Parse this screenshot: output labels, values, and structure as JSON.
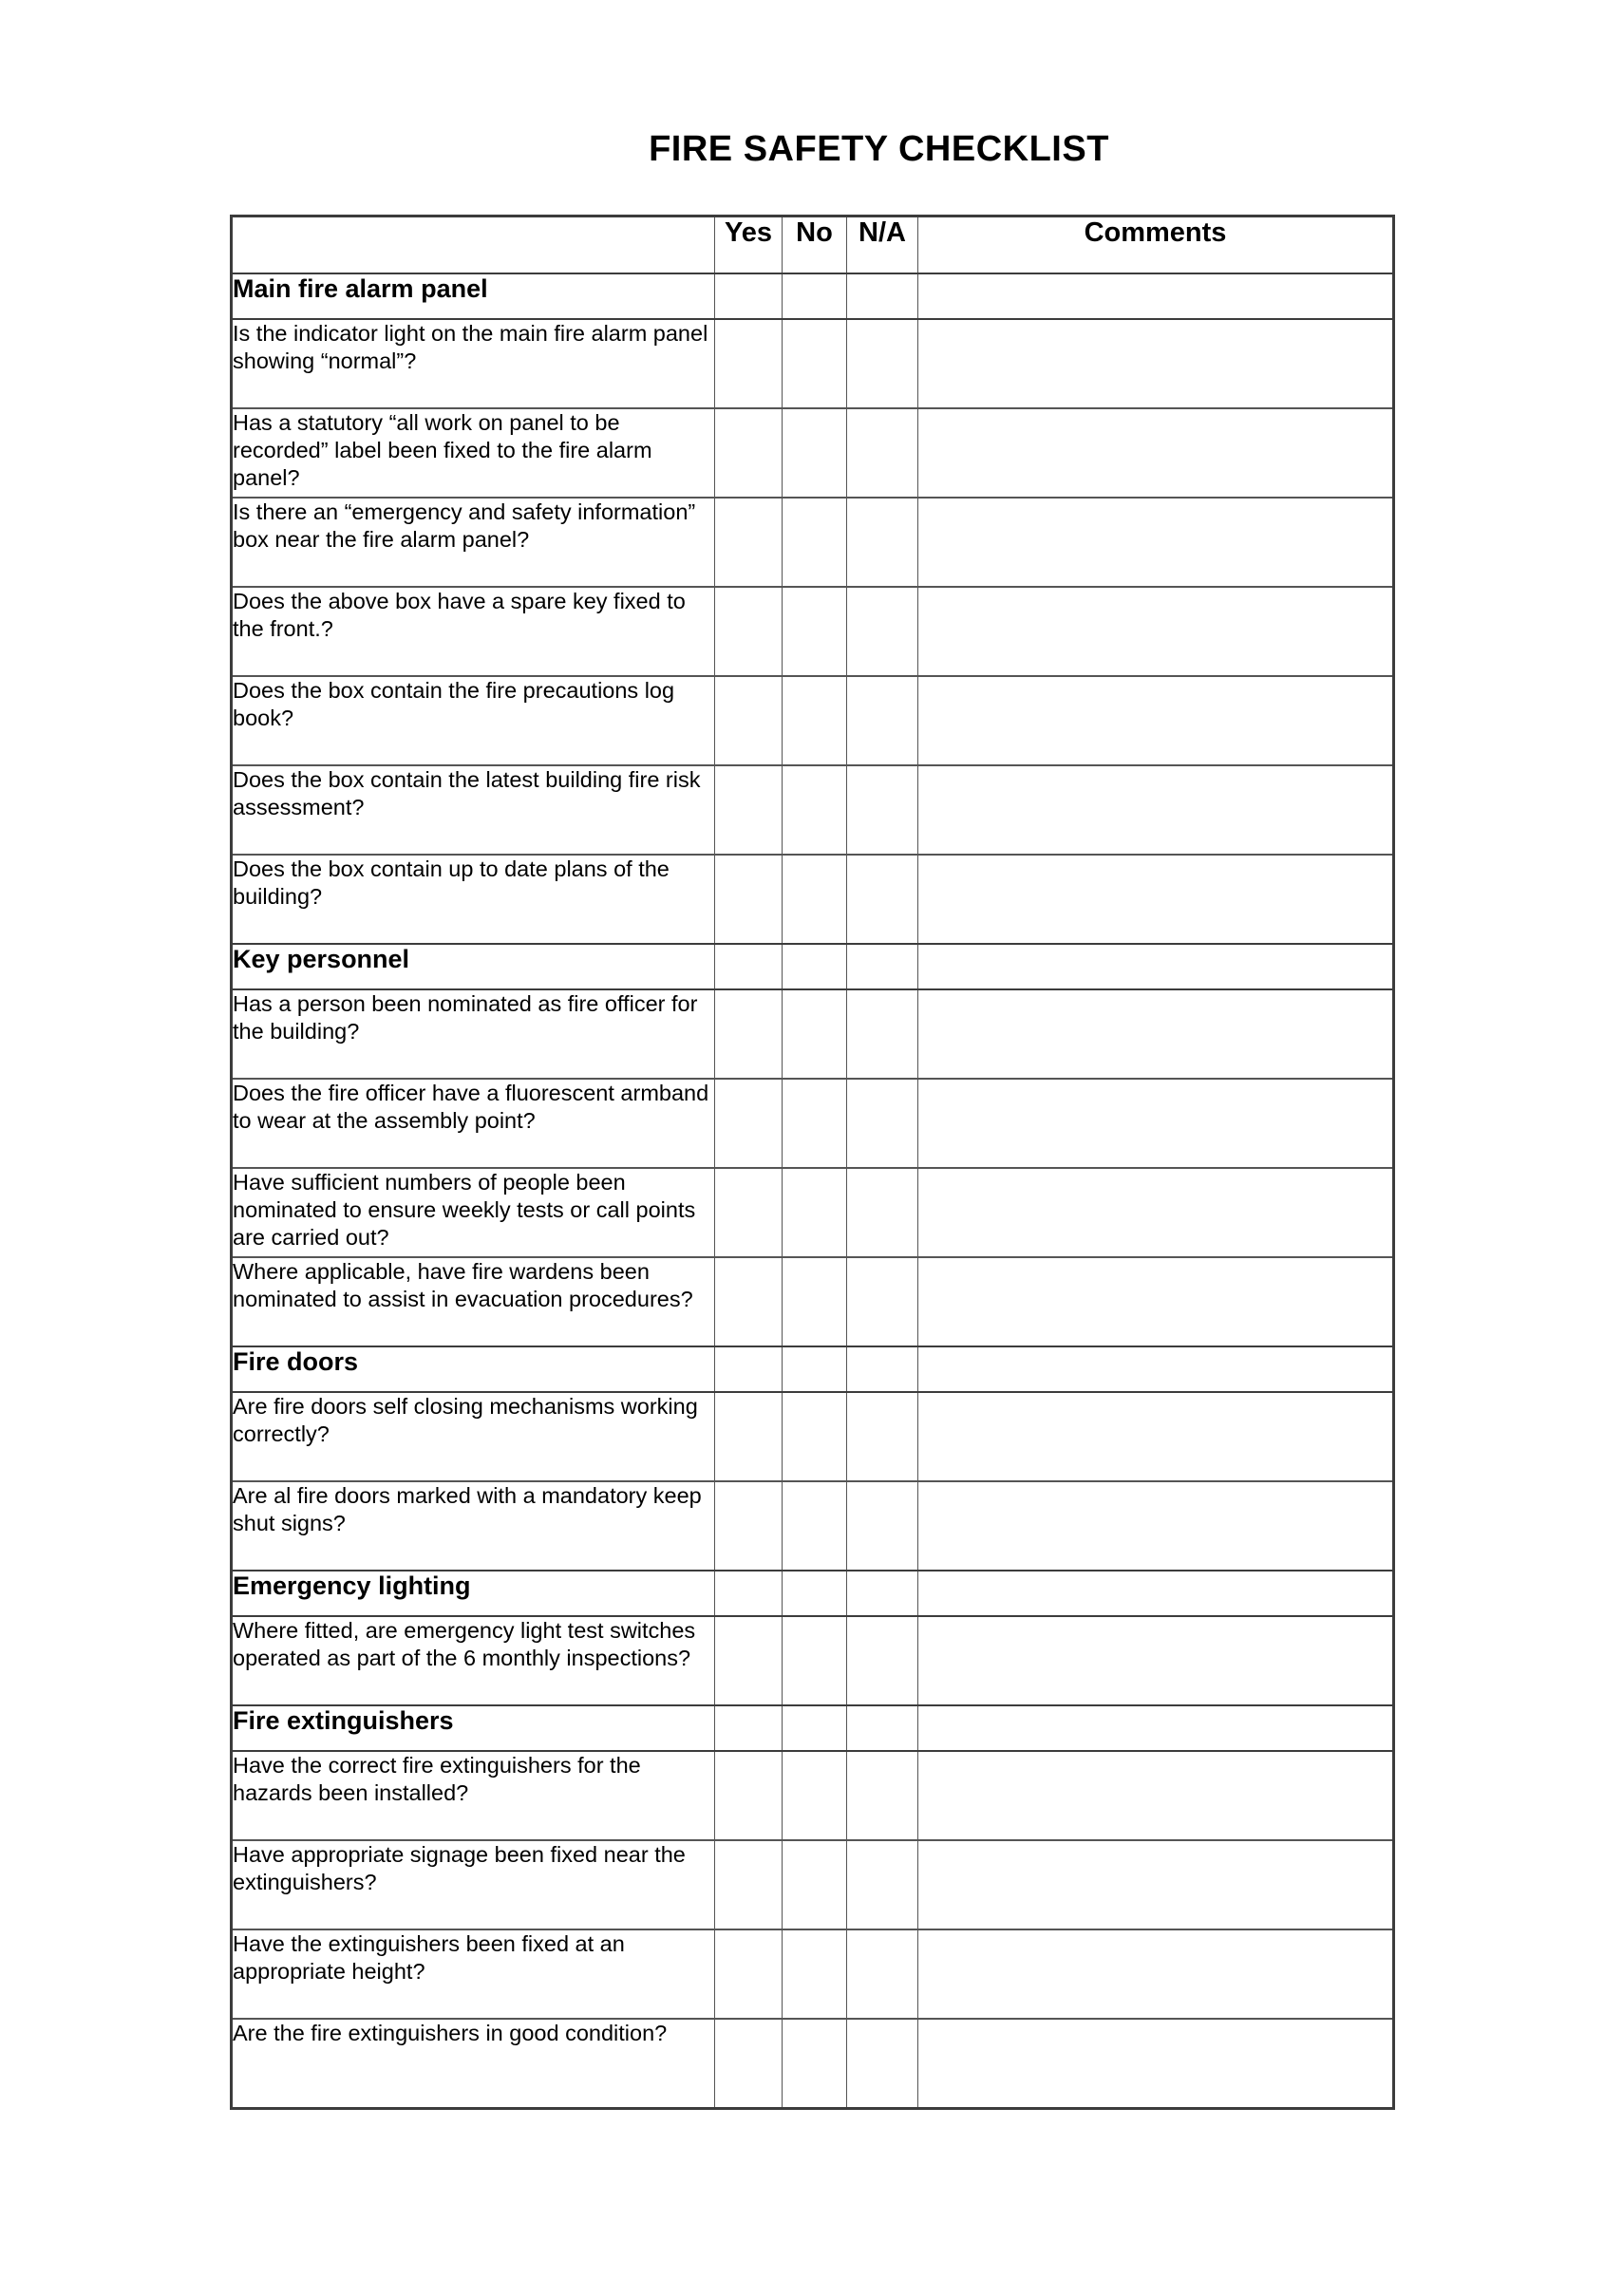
{
  "document": {
    "title": "FIRE SAFETY CHECKLIST"
  },
  "table": {
    "columns": {
      "question": "",
      "yes": "Yes",
      "no": "No",
      "na": "N/A",
      "comments": "Comments"
    },
    "sections": [
      {
        "heading": "Main fire alarm panel",
        "items": [
          {
            "text": "Is the indicator light on the main fire alarm panel showing “normal”?",
            "yes": "",
            "no": "",
            "na": "",
            "comments": ""
          },
          {
            "text": "Has a statutory “all work on panel to be recorded” label been fixed to the fire alarm panel?",
            "yes": "",
            "no": "",
            "na": "",
            "comments": ""
          },
          {
            "text": "Is there an “emergency and safety information” box near the fire alarm panel?",
            "yes": "",
            "no": "",
            "na": "",
            "comments": ""
          },
          {
            "text": "Does the above box have a spare key fixed to the front.?",
            "yes": "",
            "no": "",
            "na": "",
            "comments": ""
          },
          {
            "text": "Does the box contain the fire precautions log book?",
            "yes": "",
            "no": "",
            "na": "",
            "comments": ""
          },
          {
            "text": "Does the box contain the latest building fire risk assessment?",
            "yes": "",
            "no": "",
            "na": "",
            "comments": ""
          },
          {
            "text": "Does the box contain up to date plans of the building?",
            "yes": "",
            "no": "",
            "na": "",
            "comments": ""
          }
        ]
      },
      {
        "heading": "Key personnel",
        "items": [
          {
            "text": "Has a person been nominated as fire officer for the building?",
            "yes": "",
            "no": "",
            "na": "",
            "comments": ""
          },
          {
            "text": "Does the fire officer have a fluorescent armband to wear at the assembly point?",
            "yes": "",
            "no": "",
            "na": "",
            "comments": ""
          },
          {
            "text": "Have sufficient numbers of people been nominated to ensure weekly tests or call points are carried out?",
            "yes": "",
            "no": "",
            "na": "",
            "comments": ""
          },
          {
            "text": "Where applicable, have fire wardens been nominated to assist in evacuation procedures?",
            "yes": "",
            "no": "",
            "na": "",
            "comments": ""
          }
        ]
      },
      {
        "heading": "Fire doors",
        "items": [
          {
            "text": "Are fire doors self closing mechanisms working correctly?",
            "yes": "",
            "no": "",
            "na": "",
            "comments": ""
          },
          {
            "text": "Are al fire doors marked with a mandatory keep shut signs?",
            "yes": "",
            "no": "",
            "na": "",
            "comments": ""
          }
        ]
      },
      {
        "heading": "Emergency lighting",
        "items": [
          {
            "text": "Where fitted, are emergency light test switches operated as part of the 6 monthly inspections?",
            "yes": "",
            "no": "",
            "na": "",
            "comments": ""
          }
        ]
      },
      {
        "heading": "Fire extinguishers",
        "items": [
          {
            "text": "Have the correct fire extinguishers for the hazards been installed?",
            "yes": "",
            "no": "",
            "na": "",
            "comments": ""
          },
          {
            "text": "Have appropriate signage been fixed near the extinguishers?",
            "yes": "",
            "no": "",
            "na": "",
            "comments": ""
          },
          {
            "text": "Have the extinguishers been fixed at an appropriate height?",
            "yes": "",
            "no": "",
            "na": "",
            "comments": ""
          },
          {
            "text": "Are the fire extinguishers in good condition?",
            "yes": "",
            "no": "",
            "na": "",
            "comments": ""
          }
        ]
      }
    ]
  }
}
